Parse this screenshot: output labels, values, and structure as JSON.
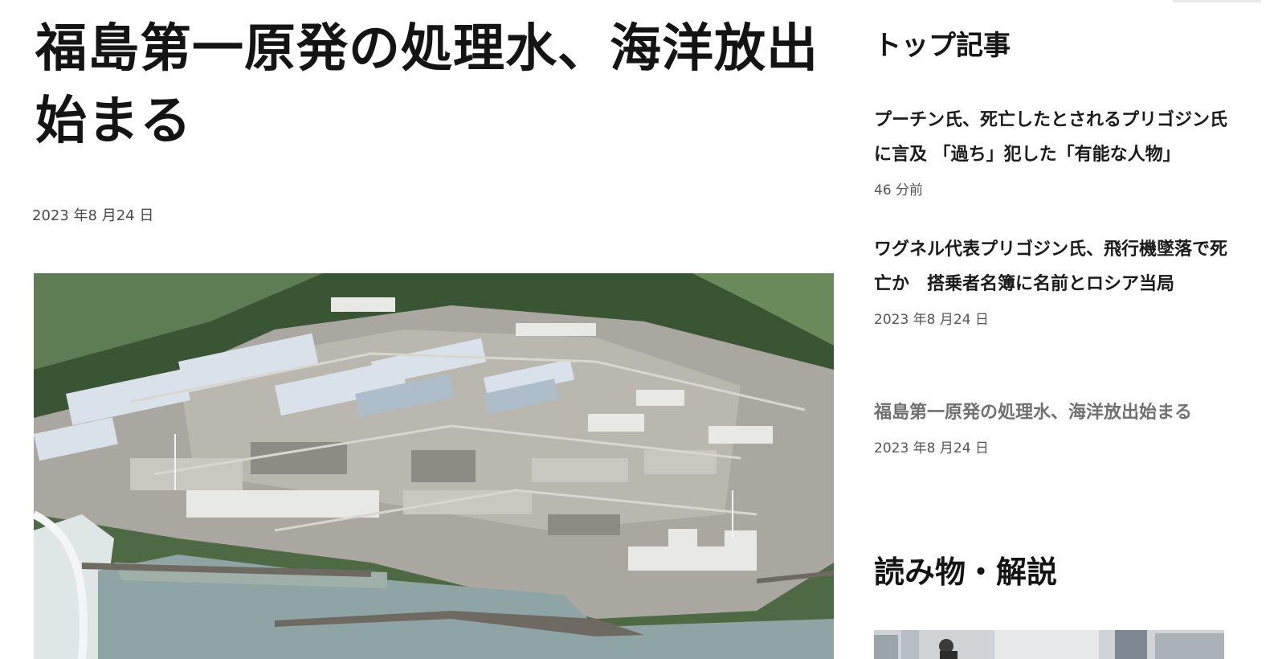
{
  "article": {
    "headline": "福島第一原発の処理水、海洋放出始まる",
    "date": "2023 年8 月24 日"
  },
  "sidebar": {
    "top_title": "トップ記事",
    "items": [
      {
        "title": "プーチン氏、死亡したとされるプリゴジン氏に言及 「過ち」犯した「有能な人物」",
        "time": "46 分前",
        "visited": false
      },
      {
        "title": "ワグネル代表プリゴジン氏、飛行機墜落で死亡か　搭乗者名簿に名前とロシア当局",
        "time": "2023 年8 月24 日",
        "visited": false
      },
      {
        "title": "福島第一原発の処理水、海洋放出始まる",
        "time": "2023 年8 月24 日",
        "visited": true
      }
    ],
    "read_title": "読み物・解説"
  },
  "colors": {
    "text": "#141414",
    "muted": "#555555",
    "visited": "#707070",
    "sea": "#8fa5a5",
    "forest": "#3f5a3a"
  }
}
